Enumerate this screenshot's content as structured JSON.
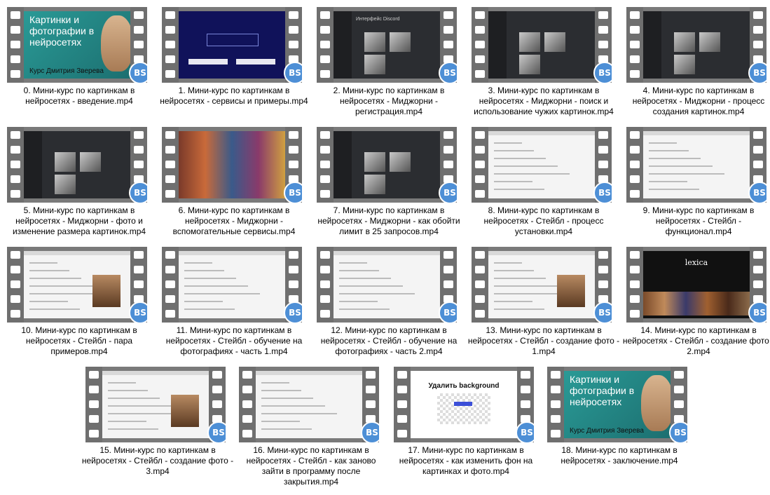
{
  "badge_text": "BS",
  "items": [
    {
      "label": "0. Мини-курс по картинкам в нейросетях - введение.mp4",
      "frame_title": "Картинки и фотографии в нейросетях",
      "frame_sub": "Курс Дмитрия Зверева",
      "style": "teal"
    },
    {
      "label": "1. Мини-курс по картинкам в нейросетях - сервисы и примеры.mp4",
      "style": "navy"
    },
    {
      "label": "2. Мини-курс по картинкам в нейросетях - Миджорни - регистрация.mp4",
      "frame_title": "Интерфейс Discord",
      "style": "dark"
    },
    {
      "label": "3. Мини-курс по картинкам в нейросетях - Миджорни - поиск и использование чужих картинок.mp4",
      "style": "dark"
    },
    {
      "label": "4. Мини-курс по картинкам в нейросетях - Миджорни - процесс создания картинок.mp4",
      "style": "dark"
    },
    {
      "label": "5. Мини-курс по картинкам в нейросетях - Миджорни - фото и изменение размера картинок.mp4",
      "style": "dark"
    },
    {
      "label": "6. Мини-курс по картинкам в нейросетях - Миджорни - вспомогательные сервисы.mp4",
      "style": "mosaic"
    },
    {
      "label": "7. Мини-курс по картинкам в нейросетях - Миджорни - как обойти лимит в 25 запросов.mp4",
      "style": "dark"
    },
    {
      "label": "8. Мини-курс по картинкам в нейросетях - Стейбл - процесс установки.mp4",
      "style": "light"
    },
    {
      "label": "9. Мини-курс по картинкам в нейросетях - Стейбл - функционал.mp4",
      "style": "light"
    },
    {
      "label": "10. Мини-курс по картинкам в нейросетях - Стейбл - пара примеров.mp4",
      "style": "light"
    },
    {
      "label": "11. Мини-курс по картинкам в нейросетях - Стейбл - обучение на фотографиях - часть 1.mp4",
      "style": "light"
    },
    {
      "label": "12. Мини-курс по картинкам в нейросетях - Стейбл - обучение на фотографиях - часть 2.mp4",
      "style": "light"
    },
    {
      "label": "13. Мини-курс по картинкам в нейросетях - Стейбл - создание фото - 1.mp4",
      "style": "light"
    },
    {
      "label": "14. Мини-курс по картинкам в нейросетях - Стейбл - создание фото - 2.mp4",
      "frame_title": "lexica",
      "style": "lexica"
    },
    {
      "label": "15. Мини-курс по картинкам в нейросетях - Стейбл - создание фото - 3.mp4",
      "style": "light"
    },
    {
      "label": "16. Мини-курс по картинкам в нейросетях - Стейбл - как заново зайти в программу после закрытия.mp4",
      "style": "light"
    },
    {
      "label": "17. Мини-курс по картинкам в нейросетях - как изменить фон на картинках и фото.mp4",
      "frame_title": "Удалить background",
      "style": "white"
    },
    {
      "label": "18. Мини-курс по картинкам в нейросетях - заключение.mp4",
      "frame_title": "Картинки и фотографии в нейросетях",
      "frame_sub": "Курс Дмитрия Зверева",
      "style": "teal"
    }
  ]
}
